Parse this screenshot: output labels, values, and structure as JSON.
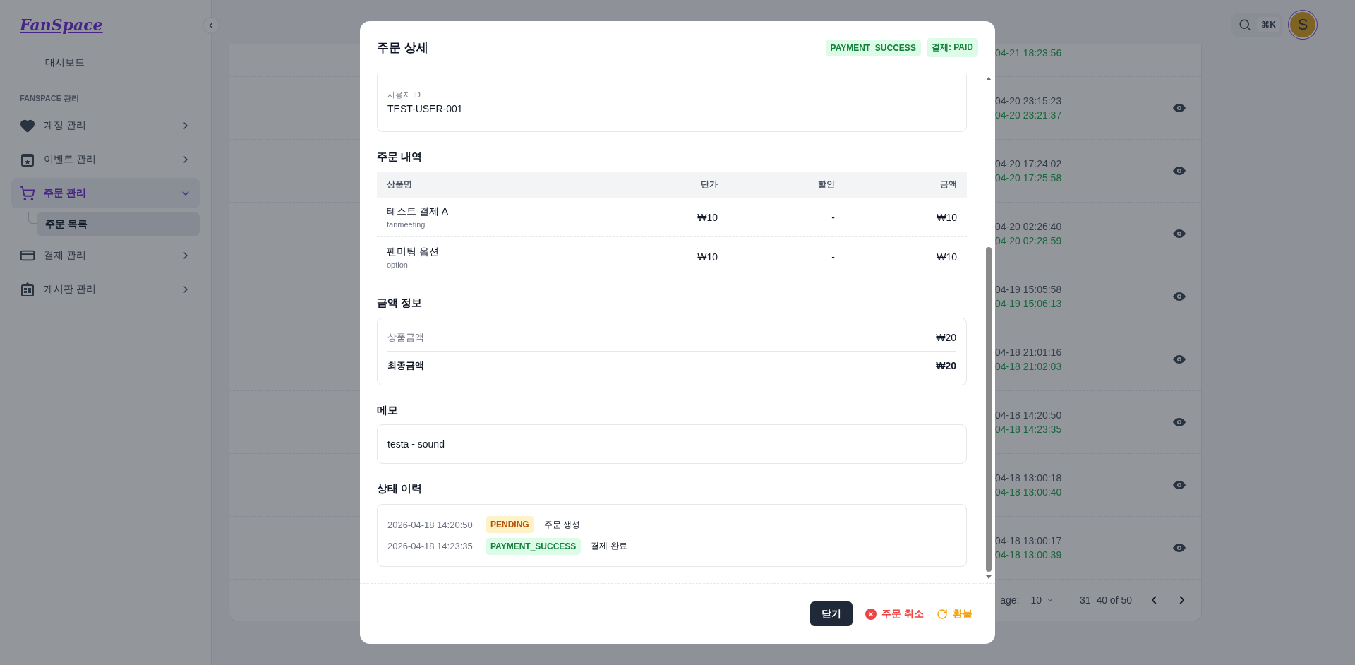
{
  "sidebar": {
    "logo": "FanSpace",
    "top_item": "대시보드",
    "section_label": "FANSPACE 관리",
    "items": [
      {
        "label": "계정 관리",
        "selected": false,
        "expanded": false
      },
      {
        "label": "이벤트 관리",
        "selected": false,
        "expanded": false
      },
      {
        "label": "주문 관리",
        "selected": true,
        "expanded": true,
        "children": [
          {
            "label": "주문 목록",
            "selected": true
          }
        ]
      },
      {
        "label": "결제 관리",
        "selected": false,
        "expanded": false
      },
      {
        "label": "게시판 관리",
        "selected": false,
        "expanded": false
      }
    ]
  },
  "topbar": {
    "shortcut": "⌘K",
    "avatar": "S"
  },
  "background_table": {
    "rows": [
      {
        "kind": "partial",
        "second_time": "04-21 18:23:56"
      },
      {
        "kind": "full",
        "first_time": "04-20 23:15:23",
        "second_time": "04-20 23:21:37"
      },
      {
        "kind": "full",
        "first_time": "04-20 17:24:02",
        "second_time": "04-20 17:25:58"
      },
      {
        "kind": "full",
        "first_time": "04-20 02:26:40",
        "second_time": "04-20 02:28:59"
      },
      {
        "kind": "full",
        "first_time": "04-19 15:05:58",
        "second_time": "04-19 15:06:13"
      },
      {
        "kind": "full",
        "first_time": "04-18 21:01:16",
        "second_time": "04-18 21:02:03"
      },
      {
        "kind": "full",
        "first_time": "04-18 14:20:50",
        "second_time": "04-18 14:23:35"
      },
      {
        "kind": "full",
        "first_time": "04-18 13:00:18",
        "second_time": "04-18 13:00:40"
      },
      {
        "kind": "full",
        "first_time": "04-18 13:00:17",
        "second_time": "04-18 13:00:39"
      }
    ],
    "pagination": {
      "rows_per_page_label": "age:",
      "rows_per_page": "10",
      "range": "31–40 of 50"
    }
  },
  "modal": {
    "title": "주문 상세",
    "badges": [
      {
        "label": "PAYMENT_SUCCESS",
        "kind": "success"
      },
      {
        "label": "결제: PAID",
        "kind": "success"
      }
    ],
    "user_field": {
      "label": "사용자 ID",
      "value": "TEST-USER-001"
    },
    "items_section": {
      "title": "주문 내역",
      "columns": [
        "상품명",
        "단가",
        "할인",
        "금액"
      ],
      "rows": [
        {
          "name": "테스트 결제 A",
          "category": "fanmeeting",
          "unit_price": "₩10",
          "discount": "-",
          "amount": "₩10"
        },
        {
          "name": "팬미팅 옵션",
          "category": "option",
          "unit_price": "₩10",
          "discount": "-",
          "amount": "₩10"
        }
      ]
    },
    "amount_section": {
      "title": "금액 정보",
      "rows": [
        {
          "kind": "subtotal",
          "label": "상품금액",
          "value": "₩20"
        },
        {
          "kind": "total",
          "label": "최종금액",
          "value": "₩20"
        }
      ]
    },
    "memo_section": {
      "title": "메모",
      "text": "testa - sound"
    },
    "history_section": {
      "title": "상태 이력",
      "entries": [
        {
          "time": "2026-04-18 14:20:50",
          "status": "PENDING",
          "kind": "warning",
          "note": "주문 생성"
        },
        {
          "time": "2026-04-18 14:23:35",
          "status": "PAYMENT_SUCCESS",
          "kind": "success",
          "note": "결제 완료"
        }
      ]
    },
    "footer": {
      "buttons": [
        {
          "kind": "close",
          "label": "닫기"
        },
        {
          "kind": "cancel",
          "label": "주문 취소"
        },
        {
          "kind": "refund",
          "label": "환불"
        }
      ]
    }
  }
}
